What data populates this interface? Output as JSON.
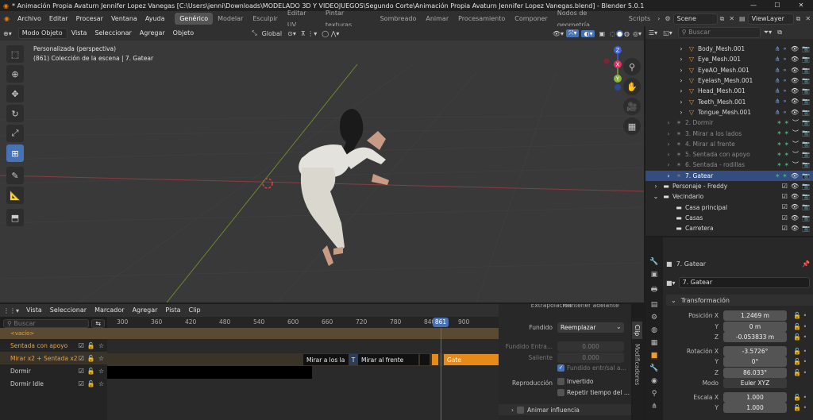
{
  "title": "* Animación Propia Avaturn Jennifer Lopez Vanegas [C:\\Users\\jenni\\Downloads\\MODELADO 3D Y VIDEOJUEGOS\\Segundo Corte\\Animación Propia Avaturn Jennifer Lopez Vanegas.blend] - Blender 5.0.1",
  "menus": [
    "Archivo",
    "Editar",
    "Procesar",
    "Ventana",
    "Ayuda"
  ],
  "workspaces": [
    "Genérico",
    "Modelar",
    "Esculpir",
    "Editar UV",
    "Pintar texturas",
    "Sombreado",
    "Animar",
    "Procesamiento",
    "Componer",
    "Nodos de geometría",
    "Scripts"
  ],
  "scene": "Scene",
  "view_layer": "ViewLayer",
  "viewport": {
    "mode": "Modo Objeto",
    "menus": [
      "Vista",
      "Seleccionar",
      "Agregar",
      "Objeto"
    ],
    "orientation": "Global",
    "info1": "Personalizada (perspectiva)",
    "info2": "(861) Colección de la escena | 7. Gatear",
    "axes": {
      "z": "Z",
      "y": "Y",
      "x": "X"
    }
  },
  "outliner": {
    "search": "Buscar",
    "items": [
      {
        "label": "Body_Mesh.001",
        "level": 3,
        "type": "mesh"
      },
      {
        "label": "Eye_Mesh.001",
        "level": 3,
        "type": "mesh"
      },
      {
        "label": "EyeAO_Mesh.001",
        "level": 3,
        "type": "mesh"
      },
      {
        "label": "Eyelash_Mesh.001",
        "level": 3,
        "type": "mesh"
      },
      {
        "label": "Head_Mesh.001",
        "level": 3,
        "type": "mesh"
      },
      {
        "label": "Teeth_Mesh.001",
        "level": 3,
        "type": "mesh"
      },
      {
        "label": "Tongue_Mesh.001",
        "level": 3,
        "type": "mesh"
      },
      {
        "label": "2. Dormir",
        "level": 2,
        "type": "armature",
        "dim": true
      },
      {
        "label": "3. Mirar a los lados",
        "level": 2,
        "type": "armature",
        "dim": true
      },
      {
        "label": "4. Mirar al frente",
        "level": 2,
        "type": "armature",
        "dim": true
      },
      {
        "label": "5. Sentada con apoyo",
        "level": 2,
        "type": "armature",
        "dim": true
      },
      {
        "label": "6. Sentada - rodillas",
        "level": 2,
        "type": "armature",
        "dim": true
      },
      {
        "label": "7. Gatear",
        "level": 2,
        "type": "armature",
        "sel": true
      },
      {
        "label": "Personaje - Freddy",
        "level": 1,
        "type": "collection"
      },
      {
        "label": "Vecindario",
        "level": 1,
        "type": "collection"
      },
      {
        "label": "Casa principal",
        "level": 2,
        "type": "collection"
      },
      {
        "label": "Casas",
        "level": 2,
        "type": "collection"
      },
      {
        "label": "Carretera",
        "level": 2,
        "type": "collection"
      }
    ]
  },
  "properties": {
    "object": "7. Gatear",
    "data": "7. Gatear",
    "section": "Transformación",
    "loc_label": "Posición X",
    "loc": [
      "1.2469 m",
      "0 m",
      "-0.053833 m"
    ],
    "rot_label": "Rotación X",
    "rot": [
      "-3.5726°",
      "0°",
      "86.033°"
    ],
    "mode_label": "Modo",
    "mode": "Euler XYZ",
    "scale_label": "Escala X",
    "scale": [
      "1.000",
      "1.000"
    ],
    "axes": [
      "X",
      "Y",
      "Z"
    ]
  },
  "nla": {
    "menus": [
      "Vista",
      "Seleccionar",
      "Marcador",
      "Agregar",
      "Pista",
      "Clip"
    ],
    "search": "Buscar",
    "frames": [
      "300",
      "360",
      "420",
      "480",
      "540",
      "600",
      "660",
      "720",
      "780",
      "840",
      "900"
    ],
    "current": "861",
    "tracks": [
      {
        "label": "<vacío>",
        "color": "#e2a34a"
      },
      {
        "label": "Sentada con apoyo",
        "color": "#e2a34a"
      },
      {
        "label": "Mirar x2 + Sentada x2",
        "color": "#e2a34a"
      },
      {
        "label": "Dormir",
        "color": "#d0d0d0"
      },
      {
        "label": "Dormir Idle",
        "color": "#d0d0d0"
      }
    ],
    "strips": {
      "a": "Mirar a los la",
      "t": "T",
      "b": "Mirar al frente",
      "c": "Gate"
    }
  },
  "strip_panel": {
    "extrap_label": "Extrapolación",
    "extrap": "Mantener adelante",
    "blend_label": "Fundido",
    "blend": "Reemplazar",
    "blend_in_label": "Fundido Entra...",
    "blend_in": "0.000",
    "blend_out_label": "Saliente",
    "blend_out": "0.000",
    "auto_blend": "Fundido entr/sal a...",
    "playback_label": "Reproducción",
    "reversed": "Invertido",
    "cyclic": "Repetir tiempo del ...",
    "animate_influence": "Animar influencia",
    "tabs": [
      "Clip",
      "Modificadores"
    ]
  }
}
